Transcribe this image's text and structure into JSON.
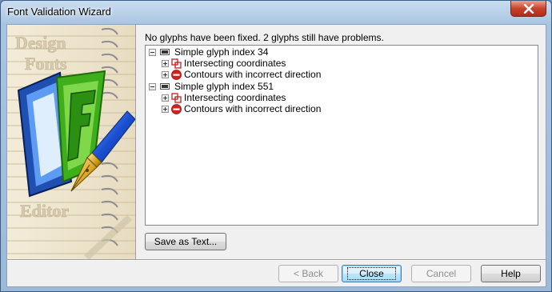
{
  "window": {
    "title": "Font Validation Wizard"
  },
  "status_message": "No glyphs have been fixed. 2 glyphs still have problems.",
  "tree": {
    "glyphs": [
      {
        "label": "Simple glyph index 34",
        "issues": [
          {
            "label": "Intersecting coordinates",
            "icon": "intersect-icon"
          },
          {
            "label": "Contours with incorrect direction",
            "icon": "error-icon"
          }
        ]
      },
      {
        "label": "Simple glyph index 551",
        "issues": [
          {
            "label": "Intersecting coordinates",
            "icon": "intersect-icon"
          },
          {
            "label": "Contours with incorrect direction",
            "icon": "error-icon"
          }
        ]
      }
    ]
  },
  "buttons": {
    "save_as_text": "Save as Text...",
    "back": "< Back",
    "close": "Close",
    "cancel": "Cancel",
    "help": "Help"
  },
  "sidepanel": {
    "logo_lines": [
      "Design",
      "Fonts",
      "Editor"
    ],
    "icon": "font-editor-pen-icon"
  },
  "colors": {
    "title_close_button": "#c7432c",
    "logo_blue": "#1f5fbf",
    "logo_green": "#4cc21f",
    "error_red": "#d22121"
  }
}
